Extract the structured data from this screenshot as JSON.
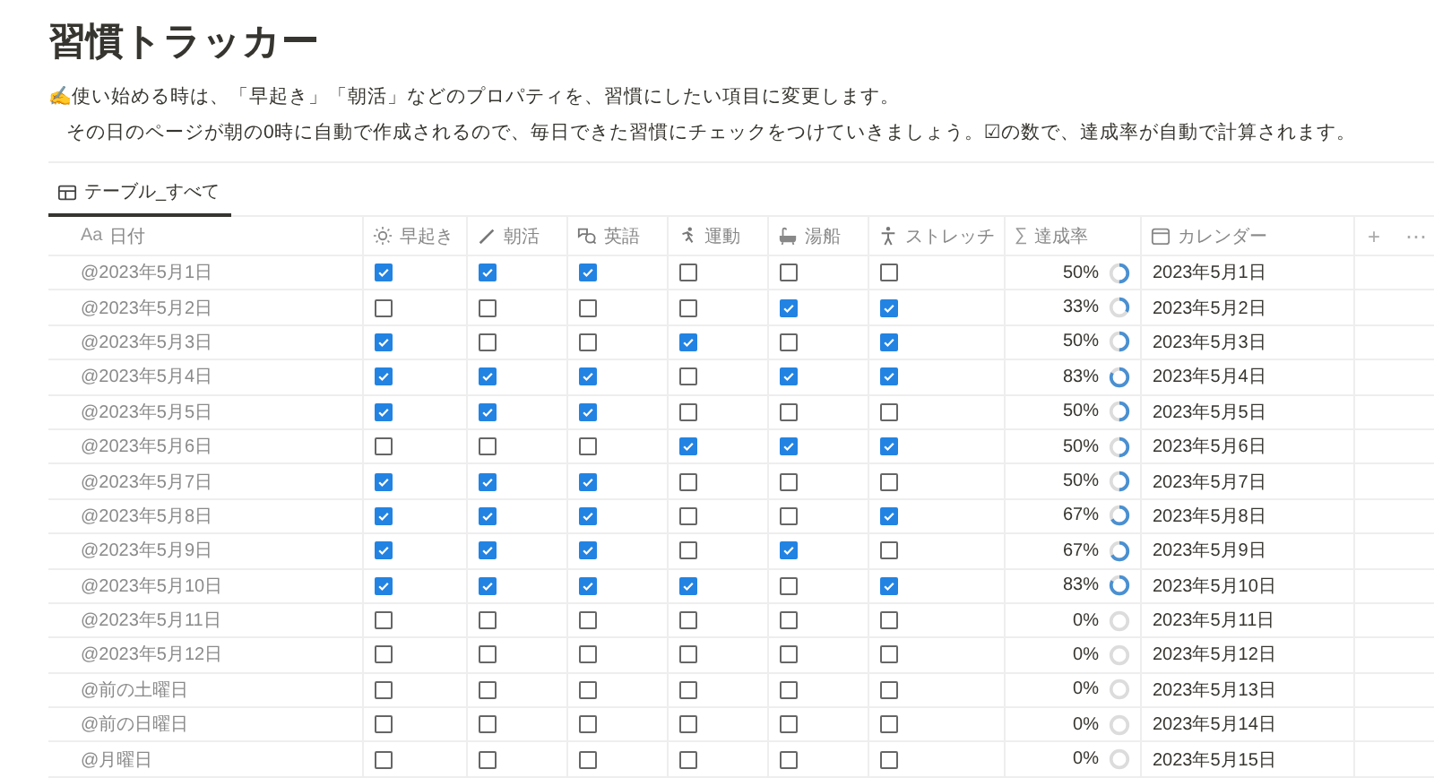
{
  "title": "習慣トラッカー",
  "description": [
    "✍️使い始める時は、「早起き」「朝活」などのプロパティを、習慣にしたい項目に変更します。",
    "その日のページが朝の0時に自動で作成されるので、毎日できた習慣にチェックをつけていきましょう。☑の数で、達成率が自動で計算されます。"
  ],
  "tabs": [
    {
      "label": "テーブル_すべて",
      "selected": true
    }
  ],
  "table": {
    "date_column": {
      "prefix": "Aa",
      "label": "日付"
    },
    "habit_columns": [
      "早起き",
      "朝活",
      "英語",
      "運動",
      "湯船",
      "ストレッチ"
    ],
    "rate_column": {
      "prefix": "∑",
      "label": "達成率"
    },
    "calendar_column": "カレンダー",
    "add_button": "+",
    "more_button": "⋯",
    "rows": [
      {
        "date": "@2023年5月1日",
        "checks": [
          true,
          true,
          true,
          false,
          false,
          false
        ],
        "rate": "50%",
        "calendar": "2023年5月1日"
      },
      {
        "date": "@2023年5月2日",
        "checks": [
          false,
          false,
          false,
          false,
          true,
          true
        ],
        "rate": "33%",
        "calendar": "2023年5月2日"
      },
      {
        "date": "@2023年5月3日",
        "checks": [
          true,
          false,
          false,
          true,
          false,
          true
        ],
        "rate": "50%",
        "calendar": "2023年5月3日"
      },
      {
        "date": "@2023年5月4日",
        "checks": [
          true,
          true,
          true,
          false,
          true,
          true
        ],
        "rate": "83%",
        "calendar": "2023年5月4日"
      },
      {
        "date": "@2023年5月5日",
        "checks": [
          true,
          true,
          true,
          false,
          false,
          false
        ],
        "rate": "50%",
        "calendar": "2023年5月5日"
      },
      {
        "date": "@2023年5月6日",
        "checks": [
          false,
          false,
          false,
          true,
          true,
          true
        ],
        "rate": "50%",
        "calendar": "2023年5月6日"
      },
      {
        "date": "@2023年5月7日",
        "checks": [
          true,
          true,
          true,
          false,
          false,
          false
        ],
        "rate": "50%",
        "calendar": "2023年5月7日"
      },
      {
        "date": "@2023年5月8日",
        "checks": [
          true,
          true,
          true,
          false,
          false,
          true
        ],
        "rate": "67%",
        "calendar": "2023年5月8日"
      },
      {
        "date": "@2023年5月9日",
        "checks": [
          true,
          true,
          true,
          false,
          true,
          false
        ],
        "rate": "67%",
        "calendar": "2023年5月9日"
      },
      {
        "date": "@2023年5月10日",
        "checks": [
          true,
          true,
          true,
          true,
          false,
          true
        ],
        "rate": "83%",
        "calendar": "2023年5月10日"
      },
      {
        "date": "@2023年5月11日",
        "checks": [
          false,
          false,
          false,
          false,
          false,
          false
        ],
        "rate": "0%",
        "calendar": "2023年5月11日"
      },
      {
        "date": "@2023年5月12日",
        "checks": [
          false,
          false,
          false,
          false,
          false,
          false
        ],
        "rate": "0%",
        "calendar": "2023年5月12日"
      },
      {
        "date": "@前の土曜日",
        "checks": [
          false,
          false,
          false,
          false,
          false,
          false
        ],
        "rate": "0%",
        "calendar": "2023年5月13日"
      },
      {
        "date": "@前の日曜日",
        "checks": [
          false,
          false,
          false,
          false,
          false,
          false
        ],
        "rate": "0%",
        "calendar": "2023年5月14日"
      },
      {
        "date": "@月曜日",
        "checks": [
          false,
          false,
          false,
          false,
          false,
          false
        ],
        "rate": "0%",
        "calendar": "2023年5月15日"
      }
    ]
  }
}
